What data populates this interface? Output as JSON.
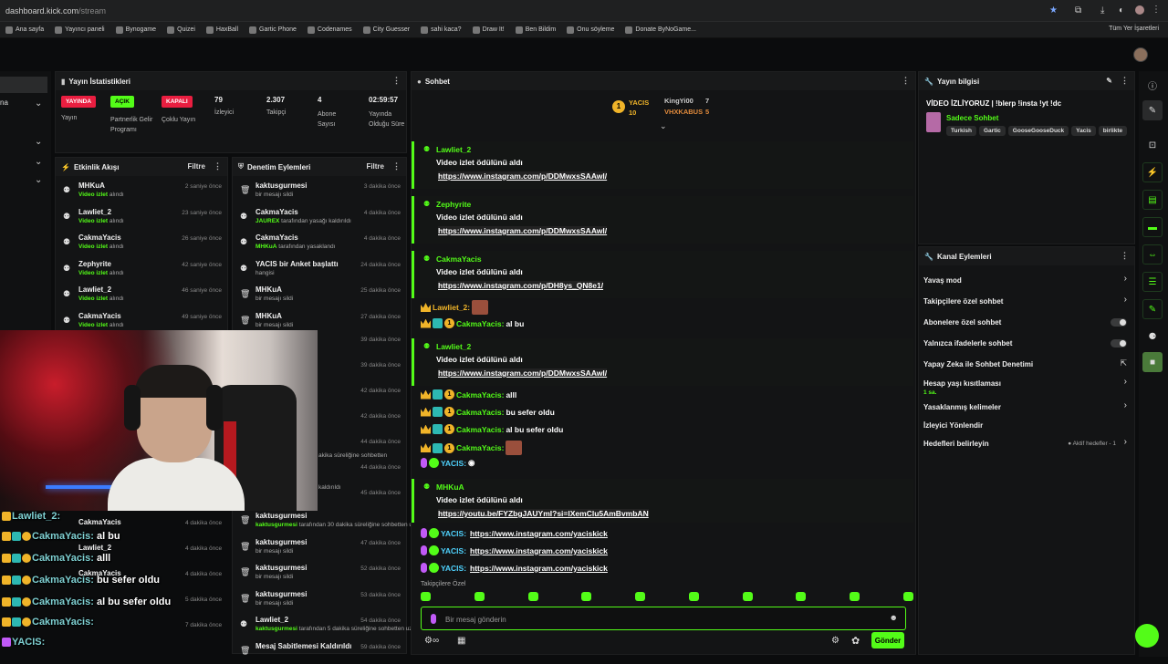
{
  "browser": {
    "url_host": "dashboard.kick.com",
    "url_path": "/stream",
    "bookmarks": [
      "Ana sayfa",
      "Yayıncı paneli",
      "Bynogame",
      "Quizei",
      "HaxBall",
      "Gartic Phone",
      "Codenames",
      "City Guesser",
      "sahi kaca?",
      "Draw It!",
      "Ben Bildim",
      "Onu söyleme",
      "Donate ByNoGame..."
    ],
    "all_bookmarks": "Tüm Yer İşaretleri"
  },
  "left": {
    "label": "na"
  },
  "stats": {
    "title": "Yayın İstatistikleri",
    "items": [
      {
        "badge": "YAYINDA",
        "label": "Yayın"
      },
      {
        "badge": "AÇIK",
        "label": "Partnerlik Gelir Programı"
      },
      {
        "badge": "KAPALI",
        "label": "Çoklu Yayın"
      },
      {
        "value": "79",
        "label": "İzleyici"
      },
      {
        "value": "2.307",
        "label": "Takipçi"
      },
      {
        "value": "4",
        "label": "Abone Sayısı"
      },
      {
        "value": "02:59:57",
        "label": "Yayında Olduğu Süre"
      }
    ]
  },
  "activity": {
    "title": "Etkinlik Akışı",
    "filter": "Filtre",
    "rows": [
      {
        "name": "MHKuA",
        "sub_hl": "Video izlet",
        "sub": " alındı",
        "time": "2 saniye önce"
      },
      {
        "name": "Lawliet_2",
        "sub_hl": "Video izlet",
        "sub": " alındı",
        "time": "23 saniye önce"
      },
      {
        "name": "CakmaYacis",
        "sub_hl": "Video izlet",
        "sub": " alındı",
        "time": "26 saniye önce"
      },
      {
        "name": "Zephyrite",
        "sub_hl": "Video izlet",
        "sub": " alındı",
        "time": "42 saniye önce"
      },
      {
        "name": "Lawliet_2",
        "sub_hl": "Video izlet",
        "sub": " alındı",
        "time": "46 saniye önce"
      },
      {
        "name": "CakmaYacis",
        "sub_hl": "Video izlet",
        "sub": " alındı",
        "time": "49 saniye önce"
      }
    ]
  },
  "moderation": {
    "title": "Denetim Eylemleri",
    "filter": "Filtre",
    "rows": [
      {
        "name": "kaktusgurmesi",
        "sub_hl": "",
        "sub": "bir mesajı sildi",
        "time": "3 dakika önce"
      },
      {
        "name": "CakmaYacis",
        "sub_hl": "JAUREX",
        "sub": " tarafından yasağı kaldırıldı",
        "time": "4 dakika önce"
      },
      {
        "name": "CakmaYacis",
        "sub_hl": "MHKuA",
        "sub": " tarafından yasaklandı",
        "time": "4 dakika önce"
      },
      {
        "name": "YACIS bir Anket başlattı",
        "sub_hl": "",
        "sub": "hangisi",
        "time": "24 dakika önce"
      },
      {
        "name": "MHKuA",
        "sub_hl": "",
        "sub": "bir mesajı sildi",
        "time": "25 dakika önce"
      },
      {
        "name": "MHKuA",
        "sub_hl": "",
        "sub": "bir mesajı sildi",
        "time": "27 dakika önce"
      }
    ],
    "hidden_times": [
      "39 dakika önce",
      "39 dakika önce",
      "42 dakika önce",
      "42 dakika önce",
      "44 dakika önce",
      "44 dakika önce",
      "45 dakika önce"
    ],
    "partial_texts": [
      "akika süreliğine sohbetten",
      "kaldırıldı"
    ],
    "lower_rows": [
      {
        "name": "kaktusgurmesi",
        "sub_hl": "kaktusgurmesi",
        "sub": " tarafından 30 dakika süreliğine sohbetten uzaklaştırıldı",
        "time": ""
      },
      {
        "name": "kaktusgurmesi",
        "sub_hl": "",
        "sub": "bir mesajı sildi",
        "time": "47 dakika önce"
      },
      {
        "name": "kaktusgurmesi",
        "sub_hl": "",
        "sub": "bir mesajı sildi",
        "time": "52 dakika önce"
      },
      {
        "name": "kaktusgurmesi",
        "sub_hl": "",
        "sub": "bir mesajı sildi",
        "time": "53 dakika önce"
      },
      {
        "name": "Lawliet_2",
        "sub_hl": "kaktusgurmesi",
        "sub": " tarafından 5 dakika süreliğine sohbetten uzaklaştırıldı",
        "time": "54 dakika önce"
      },
      {
        "name": "Mesaj Sabitlemesi Kaldırıldı",
        "sub_hl": "",
        "sub": "",
        "time": "59 dakika önce"
      }
    ],
    "activity_lower": [
      {
        "name": "CakmaYacis",
        "time": "4 dakika önce"
      },
      {
        "name": "Lawliet_2",
        "time": "4 dakika önce"
      },
      {
        "name": "CakmaYacis",
        "time": "4 dakika önce"
      },
      {
        "name": "",
        "time": "5 dakika önce"
      },
      {
        "name": "",
        "time": "7 dakika önce"
      }
    ]
  },
  "overlay": [
    {
      "name": "Lawliet_2:",
      "text": ""
    },
    {
      "name": "CakmaYacis:",
      "text": " al bu"
    },
    {
      "name": "CakmaYacis:",
      "text": " alll"
    },
    {
      "name": "CakmaYacis:",
      "text": " bu sefer oldu"
    },
    {
      "name": "CakmaYacis:",
      "text": " al bu sefer oldu"
    },
    {
      "name": "CakmaYacis:",
      "text": ""
    },
    {
      "name": "YACIS:",
      "text": ""
    }
  ],
  "chat": {
    "title": "Sohbet",
    "leaders": {
      "first": "YACIS",
      "first_count": "10",
      "second": "KingYi00",
      "second_count": "7",
      "third": "VHXKABUS",
      "third_count": "5",
      "rank": "1"
    },
    "rewards": [
      {
        "name": "Lawliet_2",
        "text": "Video izlet ödülünü aldı",
        "link": "https://www.instagram.com/p/DDMwxsSAAwl/"
      },
      {
        "name": "Zephyrite",
        "text": "Video izlet ödülünü aldı",
        "link": "https://www.instagram.com/p/DDMwxsSAAwl/"
      },
      {
        "name": "CakmaYacis",
        "text": "Video izlet ödülünü aldı",
        "link": "https://www.instagram.com/p/DH8ys_QN8e1/"
      },
      {
        "name": "Lawliet_2",
        "text": "Video izlet ödülünü aldı",
        "link": "https://www.instagram.com/p/DDMwxsSAAwl/"
      },
      {
        "name": "MHKuA",
        "text": "Video izlet ödülünü aldı",
        "link": "https://youtu.be/FYZbgJAUYmI?si=lXemClu5AmBvmbAN"
      }
    ],
    "lines": [
      {
        "name": "Lawliet_2:",
        "text": ""
      },
      {
        "name": "CakmaYacis:",
        "text": " al bu"
      },
      {
        "name": "CakmaYacis:",
        "text": " alll"
      },
      {
        "name": "CakmaYacis:",
        "text": " bu sefer oldu"
      },
      {
        "name": "CakmaYacis:",
        "text": " al bu sefer oldu"
      },
      {
        "name": "CakmaYacis:",
        "text": ""
      },
      {
        "name": "YACIS:",
        "text": ""
      }
    ],
    "yacis_links": [
      "https://www.instagram.com/yaciskick",
      "https://www.instagram.com/yaciskick",
      "https://www.instagram.com/yaciskick"
    ],
    "followers_only": "Takipçilere Özel",
    "placeholder": "Bir mesaj gönderin",
    "send": "Gönder"
  },
  "streaminfo": {
    "title": "Yayın bilgisi",
    "stream_title": "VİDEO İZLİYORUZ | !blerp !insta !yt !dc",
    "category": "Sadece Sohbet",
    "tags": [
      "Turkish",
      "Gartic",
      "GooseGooseDuck",
      "Yacis",
      "birlikte"
    ]
  },
  "channel": {
    "title": "Kanal Eylemleri",
    "items": [
      {
        "label": "Yavaş mod",
        "type": "arrow"
      },
      {
        "label": "Takipçilere özel sohbet",
        "type": "arrow"
      },
      {
        "label": "Abonelere özel sohbet",
        "type": "toggle"
      },
      {
        "label": "Yalnızca ifadelerle sohbet",
        "type": "toggle"
      },
      {
        "label": "Yapay Zeka ile Sohbet Denetimi",
        "type": "ext"
      },
      {
        "label": "Hesap yaşı kısıtlaması",
        "type": "arrow",
        "sub": "1 sa."
      },
      {
        "label": "Yasaklanmış kelimeler",
        "type": "arrow"
      },
      {
        "label": "İzleyici Yönlendir",
        "type": "none"
      },
      {
        "label": "Hedefleri belirleyin",
        "type": "arrow",
        "extra": "Aktif hedefler - 1"
      }
    ]
  },
  "colors": {
    "accent": "#53fc18",
    "live": "#e91e40",
    "panel": "#131415"
  }
}
